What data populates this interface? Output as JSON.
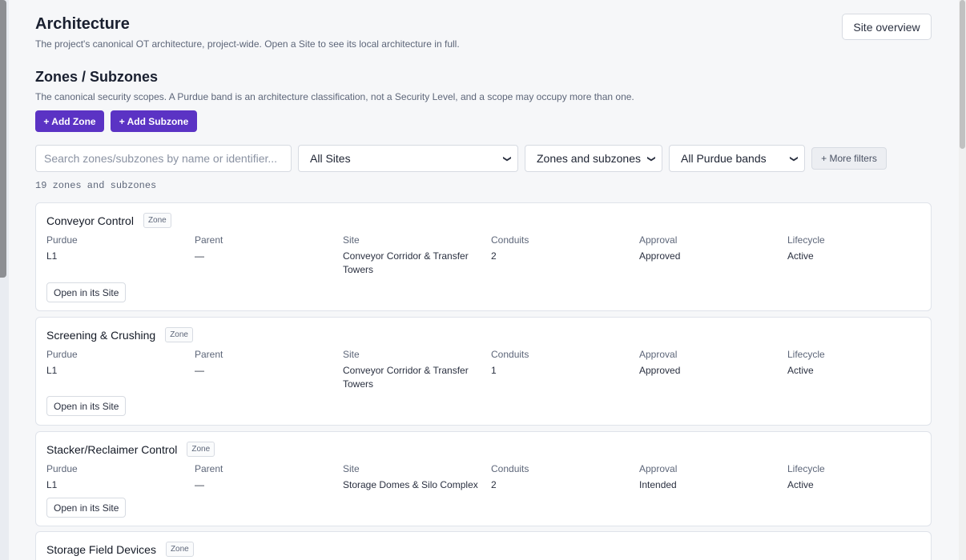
{
  "header": {
    "title": "Architecture",
    "subtitle": "The project's canonical OT architecture, project-wide. Open a Site to see its local architecture in full.",
    "site_overview_label": "Site overview"
  },
  "section": {
    "title": "Zones / Subzones",
    "subtitle": "The canonical security scopes. A Purdue band is an architecture classification, not a Security Level, and a scope may occupy more than one.",
    "add_zone_label": "+ Add Zone",
    "add_subzone_label": "+ Add Subzone"
  },
  "filters": {
    "search_placeholder": "Search zones/subzones by name or identifier...",
    "sites_selected": "All Sites",
    "kind_selected": "Zones and subzones",
    "purdue_selected": "All Purdue bands",
    "more_filters_label": "+ More filters"
  },
  "result_count": "19 zones and subzones",
  "field_labels": {
    "purdue": "Purdue",
    "parent": "Parent",
    "site": "Site",
    "conduits": "Conduits",
    "approval": "Approval",
    "lifecycle": "Lifecycle"
  },
  "open_label": "Open in its Site",
  "cards": [
    {
      "name": "Conveyor Control",
      "badge": "Zone",
      "purdue": "L1",
      "parent": "—",
      "site": "Conveyor Corridor & Transfer Towers",
      "conduits": "2",
      "approval": "Approved",
      "lifecycle": "Active"
    },
    {
      "name": "Screening & Crushing",
      "badge": "Zone",
      "purdue": "L1",
      "parent": "—",
      "site": "Conveyor Corridor & Transfer Towers",
      "conduits": "1",
      "approval": "Approved",
      "lifecycle": "Active"
    },
    {
      "name": "Stacker/Reclaimer Control",
      "badge": "Zone",
      "purdue": "L1",
      "parent": "—",
      "site": "Storage Domes & Silo Complex",
      "conduits": "2",
      "approval": "Intended",
      "lifecycle": "Active"
    },
    {
      "name": "Storage Field Devices",
      "badge": "Zone"
    }
  ]
}
